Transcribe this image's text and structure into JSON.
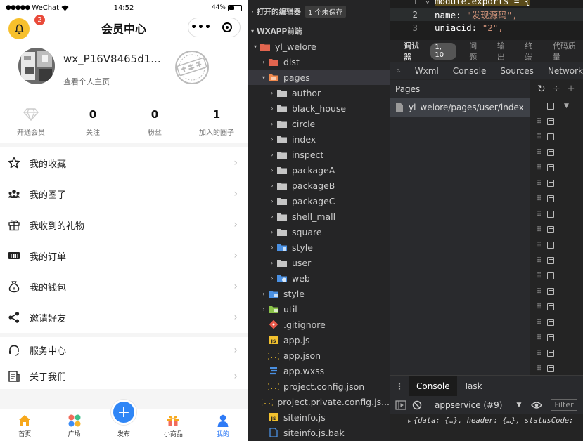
{
  "phone": {
    "status": {
      "carrier": "WeChat",
      "time": "14:52",
      "battery": "44%",
      "battery_level": 0.44
    },
    "nav": {
      "title": "会员中心",
      "notification_count": "2"
    },
    "profile": {
      "username": "wx_P16V8465d1...",
      "homepage_link": "查看个人主页"
    },
    "stats": [
      {
        "value": "",
        "label": "开通会员"
      },
      {
        "value": "0",
        "label": "关注"
      },
      {
        "value": "0",
        "label": "粉丝"
      },
      {
        "value": "1",
        "label": "加入的圈子"
      }
    ],
    "menu": [
      {
        "label": "我的收藏",
        "icon": "star-icon"
      },
      {
        "label": "我的圈子",
        "icon": "group-icon"
      },
      {
        "label": "我收到的礼物",
        "icon": "gift-icon"
      },
      {
        "label": "我的订单",
        "icon": "order-icon"
      },
      {
        "label": "我的钱包",
        "icon": "wallet-icon"
      },
      {
        "label": "邀请好友",
        "icon": "share-icon"
      }
    ],
    "menu2": [
      {
        "label": "服务中心",
        "icon": "headset-icon"
      },
      {
        "label": "关于我们",
        "icon": "document-icon"
      }
    ],
    "tabbar": [
      {
        "label": "首页",
        "icon": "home-icon"
      },
      {
        "label": "广场",
        "icon": "grid-icon"
      },
      {
        "label": "发布",
        "icon": "plus-icon"
      },
      {
        "label": "小商品",
        "icon": "shop-icon"
      },
      {
        "label": "我的",
        "icon": "user-icon"
      }
    ],
    "chevron": "›"
  },
  "explorer": {
    "open_editors": "打开的编辑器",
    "unsaved": "1 个未保存",
    "project": "WXAPP前端",
    "tree": [
      {
        "label": "yl_welore",
        "depth": 1,
        "arrow": "▾",
        "icon": "folder-red"
      },
      {
        "label": "dist",
        "depth": 2,
        "arrow": "›",
        "icon": "folder-red"
      },
      {
        "label": "pages",
        "depth": 2,
        "arrow": "▾",
        "icon": "folder-orange",
        "selected": true
      },
      {
        "label": "author",
        "depth": 3,
        "arrow": "›",
        "icon": "folder"
      },
      {
        "label": "black_house",
        "depth": 3,
        "arrow": "›",
        "icon": "folder"
      },
      {
        "label": "circle",
        "depth": 3,
        "arrow": "›",
        "icon": "folder"
      },
      {
        "label": "index",
        "depth": 3,
        "arrow": "›",
        "icon": "folder"
      },
      {
        "label": "inspect",
        "depth": 3,
        "arrow": "›",
        "icon": "folder"
      },
      {
        "label": "packageA",
        "depth": 3,
        "arrow": "›",
        "icon": "folder"
      },
      {
        "label": "packageB",
        "depth": 3,
        "arrow": "›",
        "icon": "folder"
      },
      {
        "label": "packageC",
        "depth": 3,
        "arrow": "›",
        "icon": "folder"
      },
      {
        "label": "shell_mall",
        "depth": 3,
        "arrow": "›",
        "icon": "folder"
      },
      {
        "label": "square",
        "depth": 3,
        "arrow": "›",
        "icon": "folder"
      },
      {
        "label": "style",
        "depth": 3,
        "arrow": "›",
        "icon": "folder-blue"
      },
      {
        "label": "user",
        "depth": 3,
        "arrow": "›",
        "icon": "folder"
      },
      {
        "label": "web",
        "depth": 3,
        "arrow": "›",
        "icon": "folder-blue-web"
      },
      {
        "label": "style",
        "depth": 2,
        "arrow": "›",
        "icon": "folder-blue"
      },
      {
        "label": "util",
        "depth": 2,
        "arrow": "›",
        "icon": "folder-green"
      },
      {
        "label": ".gitignore",
        "depth": 2,
        "arrow": "",
        "icon": "git-icon"
      },
      {
        "label": "app.js",
        "depth": 2,
        "arrow": "",
        "icon": "js-icon"
      },
      {
        "label": "app.json",
        "depth": 2,
        "arrow": "",
        "icon": "json-icon"
      },
      {
        "label": "app.wxss",
        "depth": 2,
        "arrow": "",
        "icon": "css-icon"
      },
      {
        "label": "project.config.json",
        "depth": 2,
        "arrow": "",
        "icon": "json-icon"
      },
      {
        "label": "project.private.config.js...",
        "depth": 2,
        "arrow": "",
        "icon": "json-icon"
      },
      {
        "label": "siteinfo.js",
        "depth": 2,
        "arrow": "",
        "icon": "js-icon"
      },
      {
        "label": "siteinfo.js.bak",
        "depth": 2,
        "arrow": "",
        "icon": "file-icon"
      }
    ]
  },
  "editor": {
    "lines": [
      {
        "num": "1",
        "key": "module.exports = {",
        "str": ""
      },
      {
        "num": "2",
        "key": "name: ",
        "str": "\"发现源码\","
      },
      {
        "num": "3",
        "key": "uniacid: ",
        "str": "\"2\","
      }
    ]
  },
  "debugger": {
    "tabs": [
      "调试器",
      "问题",
      "输出",
      "终端",
      "代码质量"
    ],
    "issue_count": "1, 10",
    "devtools_tabs": [
      "Wxml",
      "Console",
      "Sources",
      "Network"
    ],
    "pages_title": "Pages",
    "pages_item": "yl_welore/pages/user/index",
    "console_tabs": [
      "Console",
      "Task"
    ],
    "context": "appservice (#9)",
    "filter": "Filter",
    "log_line": "{data: {…}, header: {…}, statusCode:"
  }
}
